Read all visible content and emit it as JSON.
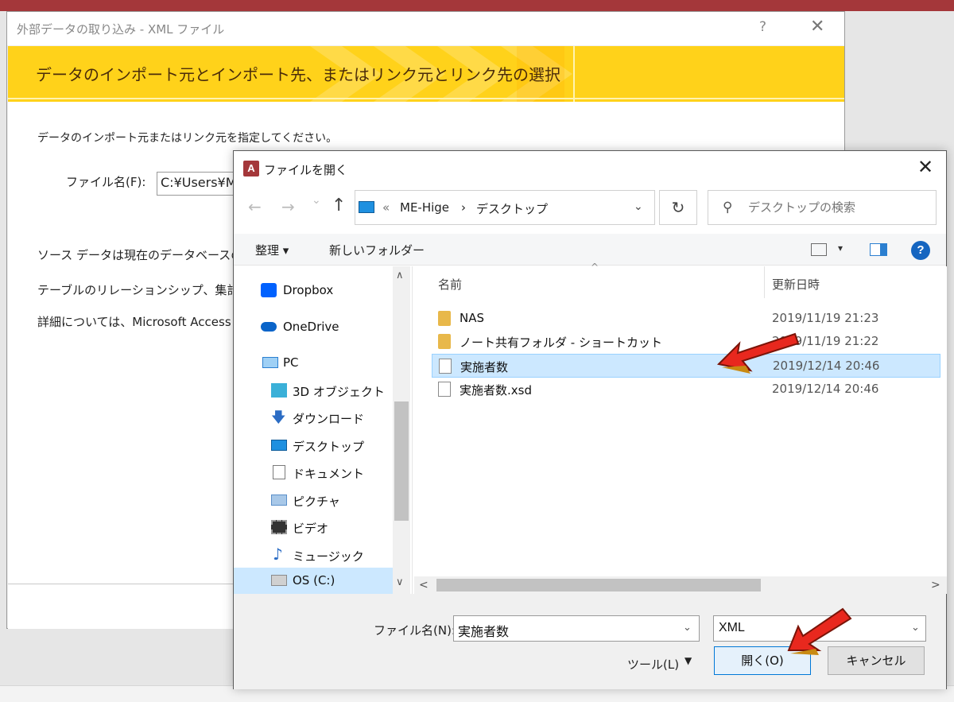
{
  "wizard": {
    "title": "外部データの取り込み - XML ファイル",
    "help": "?",
    "close": "✕",
    "banner": "データのインポート元とインポート先、またはリンク元とリンク先の選択",
    "instruction": "データのインポート元またはリンク元を指定してください。",
    "file_label": "ファイル名(F):",
    "file_value": "C:¥Users¥M",
    "text_lines": [
      "ソース データは現在のデータベースの新",
      "テーブルのリレーションシップ、集計列、",
      "詳細については、Microsoft Access ヘ"
    ]
  },
  "dialog": {
    "title": "ファイルを開く",
    "app_icon": "A",
    "close": "✕",
    "nav": {
      "back": "←",
      "forward": "→",
      "recent": "⌄",
      "up": "↑"
    },
    "address": {
      "prefix": "«",
      "seg1": "ME-Hige",
      "sep": "›",
      "seg2": "デスクトップ",
      "dropdown": "⌄"
    },
    "refresh": "↻",
    "search_placeholder": "デスクトップの検索",
    "toolbar": {
      "organize": "整理 ▾",
      "new_folder": "新しいフォルダー",
      "view_dd": "▾",
      "help": "?"
    },
    "nav_pane": [
      {
        "label": "Dropbox",
        "icon": "dropbox-icon",
        "color": "#0061fe"
      },
      {
        "label": "OneDrive",
        "icon": "onedrive-icon",
        "color": "#0a64c9"
      },
      {
        "label": "PC",
        "icon": "pc-icon",
        "color": "#2b7fd0"
      },
      {
        "label": "3D オブジェクト",
        "icon": "3d-objects-icon",
        "color": "#3ab0d8"
      },
      {
        "label": "ダウンロード",
        "icon": "download-icon",
        "color": "#2b6cc4"
      },
      {
        "label": "デスクトップ",
        "icon": "desktop-icon",
        "color": "#1e90e0"
      },
      {
        "label": "ドキュメント",
        "icon": "documents-icon",
        "color": "#7a7a7a"
      },
      {
        "label": "ピクチャ",
        "icon": "pictures-icon",
        "color": "#5a8fc9"
      },
      {
        "label": "ビデオ",
        "icon": "videos-icon",
        "color": "#333333"
      },
      {
        "label": "ミュージック",
        "icon": "music-icon",
        "color": "#2b6cc4"
      },
      {
        "label": "OS (C:)",
        "icon": "drive-icon",
        "color": "#8a8a8a"
      }
    ],
    "columns": {
      "name": "名前",
      "modified": "更新日時",
      "sort": "^"
    },
    "files": [
      {
        "name": "NAS",
        "date": "2019/11/19 21:23",
        "type": "folder-shortcut"
      },
      {
        "name": "ノート共有フォルダ - ショートカット",
        "date": "2019/11/19 21:22",
        "type": "folder-shortcut"
      },
      {
        "name": "実施者数",
        "date": "2019/12/14 20:46",
        "type": "file"
      },
      {
        "name": "実施者数.xsd",
        "date": "2019/12/14 20:46",
        "type": "file"
      }
    ],
    "scroll": {
      "up": "∧",
      "down": "∨",
      "left": "<",
      "right": ">"
    },
    "file_name_label": "ファイル名(N):",
    "file_name_value": "実施者数",
    "file_type_value": "XML",
    "dropdown": "⌄",
    "tools": "ツール(L)",
    "tools_dd": "▼",
    "open_button": "開く(O)",
    "cancel_button": "キャンセル"
  },
  "colors": {
    "banner": "#ffd21a",
    "selection": "#cce8ff",
    "accent": "#0078d7",
    "arrow": "#e8281e"
  }
}
